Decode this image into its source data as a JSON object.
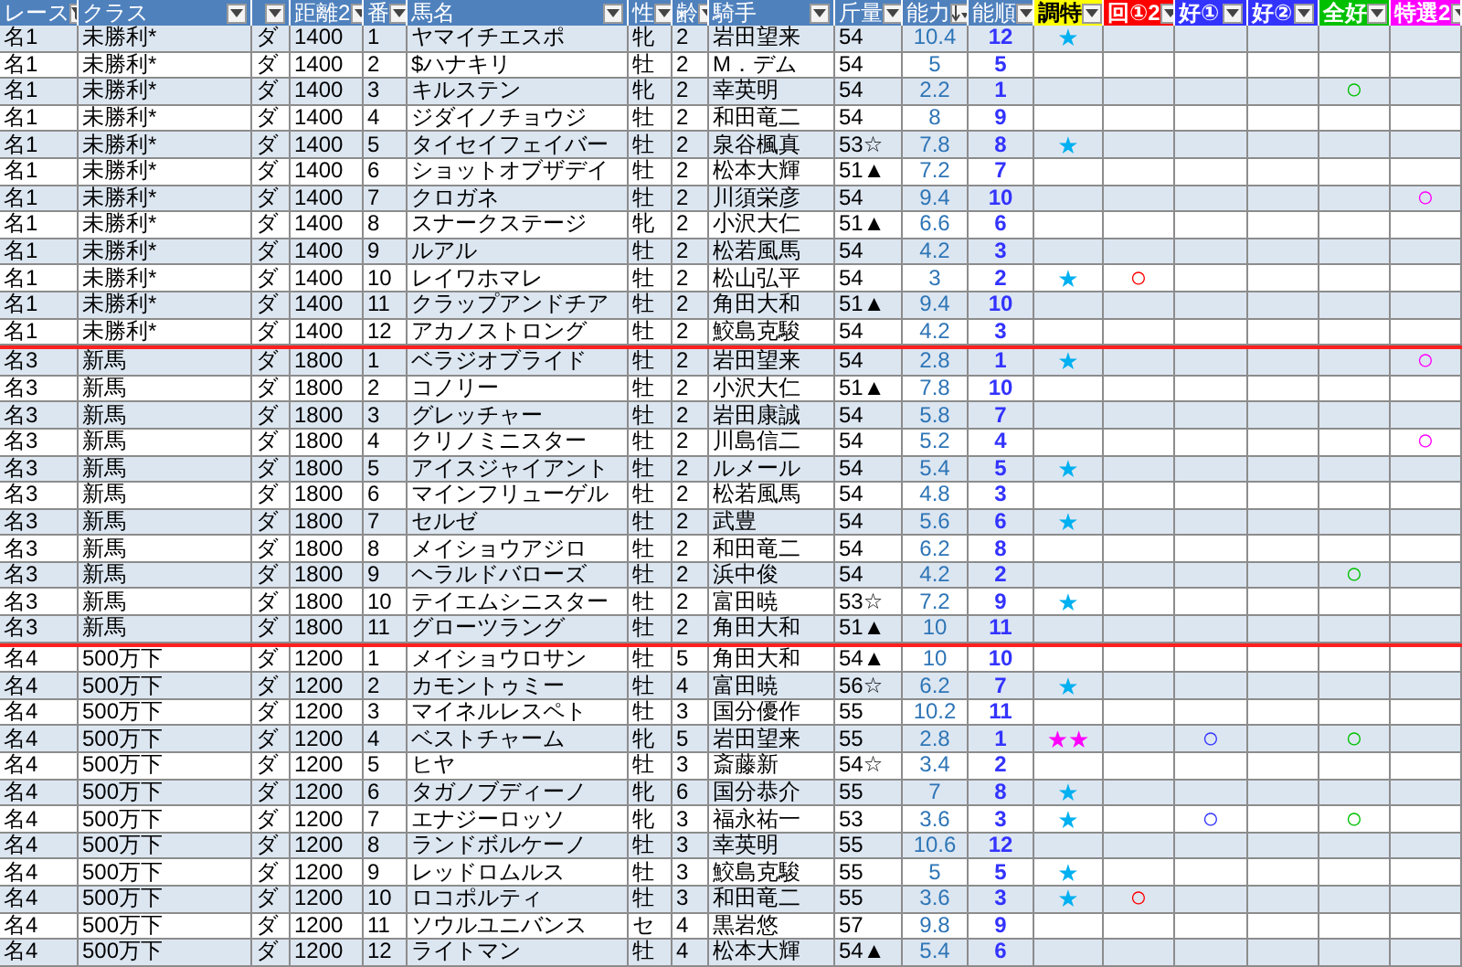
{
  "columns": [
    {
      "label": "レース",
      "kind": "filtered"
    },
    {
      "label": "クラス",
      "kind": "dropdown"
    },
    {
      "kind": "dropdown"
    },
    {
      "label": "距離2",
      "kind": "dropdown"
    },
    {
      "label": "番",
      "kind": "dropdown"
    },
    {
      "label": "馬名",
      "kind": "dropdown"
    },
    {
      "label": "性",
      "kind": "dropdown"
    },
    {
      "label": "齢",
      "kind": "dropdown"
    },
    {
      "label": "騎手",
      "kind": "dropdown"
    },
    {
      "label": "斤量",
      "kind": "dropdown"
    },
    {
      "label": "能力",
      "kind": "sorted"
    },
    {
      "label": "能順",
      "kind": "dropdown"
    },
    {
      "label": "調特",
      "kind": "dropdown",
      "color": "#ffff00"
    },
    {
      "label": "回①2",
      "kind": "dropdown",
      "color": "#ff0000"
    },
    {
      "label": "好①",
      "kind": "dropdown",
      "color": "#3333ff"
    },
    {
      "label": "好②",
      "kind": "dropdown",
      "color": "#3333ff"
    },
    {
      "label": "全好",
      "kind": "dropdown",
      "color": "#00c000"
    },
    {
      "label": "特選2",
      "kind": "dropdown",
      "color": "#ff00ff"
    }
  ],
  "groups": [
    {
      "rows": [
        {
          "race": "名1",
          "class": "未勝利*",
          "course": "ダ",
          "distance": "1400",
          "number": "1",
          "horse": "ヤマイチエスポ",
          "sex": "牝",
          "age": "2",
          "jockey": "岩田望来",
          "weight": "54",
          "ability": "10.4",
          "rank": "12",
          "choutoku": {
            "text": "★",
            "color": "#00b0f0"
          }
        },
        {
          "race": "名1",
          "class": "未勝利*",
          "course": "ダ",
          "distance": "1400",
          "number": "2",
          "horse": "$ハナキリ",
          "sex": "牡",
          "age": "2",
          "jockey": "M．デム",
          "weight": "54",
          "ability": "5",
          "rank": "5"
        },
        {
          "race": "名1",
          "class": "未勝利*",
          "course": "ダ",
          "distance": "1400",
          "number": "3",
          "horse": "キルステン",
          "sex": "牝",
          "age": "2",
          "jockey": "幸英明",
          "weight": "54",
          "ability": "2.2",
          "rank": "1",
          "zenkou": "○"
        },
        {
          "race": "名1",
          "class": "未勝利*",
          "course": "ダ",
          "distance": "1400",
          "number": "4",
          "horse": "ジダイノチョウジ",
          "sex": "牡",
          "age": "2",
          "jockey": "和田竜二",
          "weight": "54",
          "ability": "8",
          "rank": "9"
        },
        {
          "race": "名1",
          "class": "未勝利*",
          "course": "ダ",
          "distance": "1400",
          "number": "5",
          "horse": "タイセイフェイバー",
          "sex": "牡",
          "age": "2",
          "jockey": "泉谷楓真",
          "weight": "53☆",
          "ability": "7.8",
          "rank": "8",
          "choutoku": {
            "text": "★",
            "color": "#00b0f0"
          }
        },
        {
          "race": "名1",
          "class": "未勝利*",
          "course": "ダ",
          "distance": "1400",
          "number": "6",
          "horse": "ショットオブザデイ",
          "sex": "牡",
          "age": "2",
          "jockey": "松本大輝",
          "weight": "51▲",
          "ability": "7.2",
          "rank": "7"
        },
        {
          "race": "名1",
          "class": "未勝利*",
          "course": "ダ",
          "distance": "1400",
          "number": "7",
          "horse": "クロガネ",
          "sex": "牡",
          "age": "2",
          "jockey": "川須栄彦",
          "weight": "54",
          "ability": "9.4",
          "rank": "10",
          "tokusen": "○"
        },
        {
          "race": "名1",
          "class": "未勝利*",
          "course": "ダ",
          "distance": "1400",
          "number": "8",
          "horse": "スナークステージ",
          "sex": "牝",
          "age": "2",
          "jockey": "小沢大仁",
          "weight": "51▲",
          "ability": "6.6",
          "rank": "6"
        },
        {
          "race": "名1",
          "class": "未勝利*",
          "course": "ダ",
          "distance": "1400",
          "number": "9",
          "horse": "ルアル",
          "sex": "牡",
          "age": "2",
          "jockey": "松若風馬",
          "weight": "54",
          "ability": "4.2",
          "rank": "3"
        },
        {
          "race": "名1",
          "class": "未勝利*",
          "course": "ダ",
          "distance": "1400",
          "number": "10",
          "horse": "レイワホマレ",
          "sex": "牡",
          "age": "2",
          "jockey": "松山弘平",
          "weight": "54",
          "ability": "3",
          "rank": "2",
          "choutoku": {
            "text": "★",
            "color": "#00b0f0"
          },
          "kai": "○"
        },
        {
          "race": "名1",
          "class": "未勝利*",
          "course": "ダ",
          "distance": "1400",
          "number": "11",
          "horse": "クラップアンドチア",
          "sex": "牡",
          "age": "2",
          "jockey": "角田大和",
          "weight": "51▲",
          "ability": "9.4",
          "rank": "10"
        },
        {
          "race": "名1",
          "class": "未勝利*",
          "course": "ダ",
          "distance": "1400",
          "number": "12",
          "horse": "アカノストロング",
          "sex": "牡",
          "age": "2",
          "jockey": "鮫島克駿",
          "weight": "54",
          "ability": "4.2",
          "rank": "3"
        }
      ]
    },
    {
      "rows": [
        {
          "race": "名3",
          "class": "新馬",
          "course": "ダ",
          "distance": "1800",
          "number": "1",
          "horse": "ベラジオブライド",
          "sex": "牡",
          "age": "2",
          "jockey": "岩田望来",
          "weight": "54",
          "ability": "2.8",
          "rank": "1",
          "choutoku": {
            "text": "★",
            "color": "#00b0f0"
          },
          "tokusen": "○"
        },
        {
          "race": "名3",
          "class": "新馬",
          "course": "ダ",
          "distance": "1800",
          "number": "2",
          "horse": "コノリー",
          "sex": "牡",
          "age": "2",
          "jockey": "小沢大仁",
          "weight": "51▲",
          "ability": "7.8",
          "rank": "10"
        },
        {
          "race": "名3",
          "class": "新馬",
          "course": "ダ",
          "distance": "1800",
          "number": "3",
          "horse": "グレッチャー",
          "sex": "牡",
          "age": "2",
          "jockey": "岩田康誠",
          "weight": "54",
          "ability": "5.8",
          "rank": "7"
        },
        {
          "race": "名3",
          "class": "新馬",
          "course": "ダ",
          "distance": "1800",
          "number": "4",
          "horse": "クリノミニスター",
          "sex": "牡",
          "age": "2",
          "jockey": "川島信二",
          "weight": "54",
          "ability": "5.2",
          "rank": "4",
          "tokusen": "○"
        },
        {
          "race": "名3",
          "class": "新馬",
          "course": "ダ",
          "distance": "1800",
          "number": "5",
          "horse": "アイスジャイアント",
          "sex": "牡",
          "age": "2",
          "jockey": "ルメール",
          "weight": "54",
          "ability": "5.4",
          "rank": "5",
          "choutoku": {
            "text": "★",
            "color": "#00b0f0"
          }
        },
        {
          "race": "名3",
          "class": "新馬",
          "course": "ダ",
          "distance": "1800",
          "number": "6",
          "horse": "マインフリューゲル",
          "sex": "牡",
          "age": "2",
          "jockey": "松若風馬",
          "weight": "54",
          "ability": "4.8",
          "rank": "3"
        },
        {
          "race": "名3",
          "class": "新馬",
          "course": "ダ",
          "distance": "1800",
          "number": "7",
          "horse": "セルゼ",
          "sex": "牡",
          "age": "2",
          "jockey": "武豊",
          "weight": "54",
          "ability": "5.6",
          "rank": "6",
          "choutoku": {
            "text": "★",
            "color": "#00b0f0"
          }
        },
        {
          "race": "名3",
          "class": "新馬",
          "course": "ダ",
          "distance": "1800",
          "number": "8",
          "horse": "メイショウアジロ",
          "sex": "牡",
          "age": "2",
          "jockey": "和田竜二",
          "weight": "54",
          "ability": "6.2",
          "rank": "8"
        },
        {
          "race": "名3",
          "class": "新馬",
          "course": "ダ",
          "distance": "1800",
          "number": "9",
          "horse": "ヘラルドバローズ",
          "sex": "牡",
          "age": "2",
          "jockey": "浜中俊",
          "weight": "54",
          "ability": "4.2",
          "rank": "2",
          "zenkou": "○"
        },
        {
          "race": "名3",
          "class": "新馬",
          "course": "ダ",
          "distance": "1800",
          "number": "10",
          "horse": "テイエムシニスター",
          "sex": "牡",
          "age": "2",
          "jockey": "富田暁",
          "weight": "53☆",
          "ability": "7.2",
          "rank": "9",
          "choutoku": {
            "text": "★",
            "color": "#00b0f0"
          }
        },
        {
          "race": "名3",
          "class": "新馬",
          "course": "ダ",
          "distance": "1800",
          "number": "11",
          "horse": "グローツラング",
          "sex": "牡",
          "age": "2",
          "jockey": "角田大和",
          "weight": "51▲",
          "ability": "10",
          "rank": "11"
        }
      ]
    },
    {
      "rows": [
        {
          "race": "名4",
          "class": "500万下",
          "course": "ダ",
          "distance": "1200",
          "number": "1",
          "horse": "メイショウロサン",
          "sex": "牡",
          "age": "5",
          "jockey": "角田大和",
          "weight": "54▲",
          "ability": "10",
          "rank": "10"
        },
        {
          "race": "名4",
          "class": "500万下",
          "course": "ダ",
          "distance": "1200",
          "number": "2",
          "horse": "カモントゥミー",
          "sex": "牡",
          "age": "4",
          "jockey": "富田暁",
          "weight": "56☆",
          "ability": "6.2",
          "rank": "7",
          "choutoku": {
            "text": "★",
            "color": "#00b0f0"
          }
        },
        {
          "race": "名4",
          "class": "500万下",
          "course": "ダ",
          "distance": "1200",
          "number": "3",
          "horse": "マイネルレスペト",
          "sex": "牡",
          "age": "3",
          "jockey": "国分優作",
          "weight": "55",
          "ability": "10.2",
          "rank": "11"
        },
        {
          "race": "名4",
          "class": "500万下",
          "course": "ダ",
          "distance": "1200",
          "number": "4",
          "horse": "ベストチャーム",
          "sex": "牝",
          "age": "5",
          "jockey": "岩田望来",
          "weight": "55",
          "ability": "2.8",
          "rank": "1",
          "choutoku": {
            "text": "★★",
            "color": "#ff00ff"
          },
          "kou1": "○",
          "zenkou": "○"
        },
        {
          "race": "名4",
          "class": "500万下",
          "course": "ダ",
          "distance": "1200",
          "number": "5",
          "horse": "ヒヤ",
          "sex": "牡",
          "age": "3",
          "jockey": "斎藤新",
          "weight": "54☆",
          "ability": "3.4",
          "rank": "2"
        },
        {
          "race": "名4",
          "class": "500万下",
          "course": "ダ",
          "distance": "1200",
          "number": "6",
          "horse": "タガノブディーノ",
          "sex": "牝",
          "age": "6",
          "jockey": "国分恭介",
          "weight": "55",
          "ability": "7",
          "rank": "8",
          "choutoku": {
            "text": "★",
            "color": "#00b0f0"
          }
        },
        {
          "race": "名4",
          "class": "500万下",
          "course": "ダ",
          "distance": "1200",
          "number": "7",
          "horse": "エナジーロッソ",
          "sex": "牝",
          "age": "3",
          "jockey": "福永祐一",
          "weight": "53",
          "ability": "3.6",
          "rank": "3",
          "choutoku": {
            "text": "★",
            "color": "#00b0f0"
          },
          "kou1": "○",
          "zenkou": "○"
        },
        {
          "race": "名4",
          "class": "500万下",
          "course": "ダ",
          "distance": "1200",
          "number": "8",
          "horse": "ランドボルケーノ",
          "sex": "牡",
          "age": "3",
          "jockey": "幸英明",
          "weight": "55",
          "ability": "10.6",
          "rank": "12"
        },
        {
          "race": "名4",
          "class": "500万下",
          "course": "ダ",
          "distance": "1200",
          "number": "9",
          "horse": "レッドロムルス",
          "sex": "牡",
          "age": "3",
          "jockey": "鮫島克駿",
          "weight": "55",
          "ability": "5",
          "rank": "5",
          "choutoku": {
            "text": "★",
            "color": "#00b0f0"
          }
        },
        {
          "race": "名4",
          "class": "500万下",
          "course": "ダ",
          "distance": "1200",
          "number": "10",
          "horse": "ロコポルティ",
          "sex": "牡",
          "age": "3",
          "jockey": "和田竜二",
          "weight": "55",
          "ability": "3.6",
          "rank": "3",
          "choutoku": {
            "text": "★",
            "color": "#00b0f0"
          },
          "kai": "○"
        },
        {
          "race": "名4",
          "class": "500万下",
          "course": "ダ",
          "distance": "1200",
          "number": "11",
          "horse": "ソウルユニバンス",
          "sex": "セ",
          "age": "4",
          "jockey": "黒岩悠",
          "weight": "57",
          "ability": "9.8",
          "rank": "9"
        },
        {
          "race": "名4",
          "class": "500万下",
          "course": "ダ",
          "distance": "1200",
          "number": "12",
          "horse": "ライトマン",
          "sex": "牡",
          "age": "4",
          "jockey": "松本大輝",
          "weight": "54▲",
          "ability": "5.4",
          "rank": "6"
        }
      ]
    }
  ]
}
